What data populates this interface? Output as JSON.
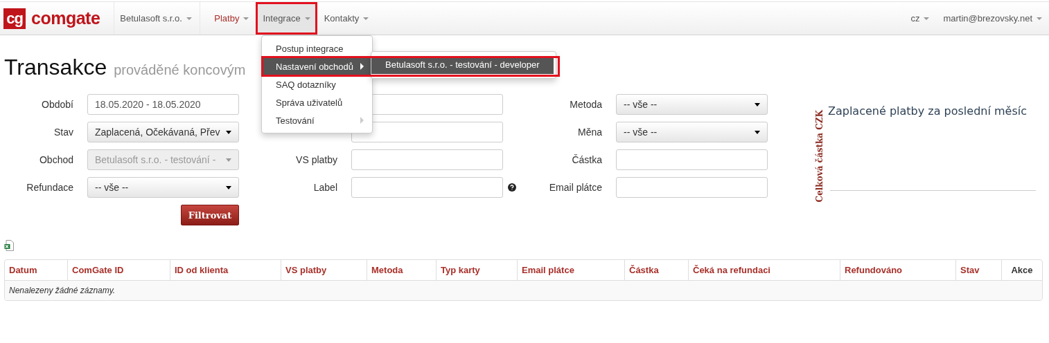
{
  "logo": {
    "mark": "cg",
    "name": "comgate"
  },
  "navbar": {
    "merchant": "Betulasoft s.r.o.",
    "items": [
      {
        "label": "Platby",
        "selected": true,
        "expanded": false,
        "highlighted": false
      },
      {
        "label": "Integrace",
        "selected": false,
        "expanded": true,
        "highlighted": true
      },
      {
        "label": "Kontakty",
        "selected": false,
        "expanded": false,
        "highlighted": false
      }
    ],
    "language": "cz",
    "user": "martin@brezovsky.net"
  },
  "dropdown": {
    "items": [
      {
        "label": "Postup integrace",
        "selected": false,
        "submenu": false,
        "highlighted": false
      },
      {
        "label": "Nastavení obchodů",
        "selected": true,
        "submenu": true,
        "highlighted": true
      },
      {
        "label": "SAQ dotazníky",
        "selected": false,
        "submenu": false,
        "highlighted": false
      },
      {
        "label": "Správa uživatelů",
        "selected": false,
        "submenu": false,
        "highlighted": false
      },
      {
        "label": "Testování",
        "selected": false,
        "submenu": true,
        "highlighted": false
      }
    ],
    "submenu": {
      "items": [
        {
          "label": "Betulasoft s.r.o. - testování - developer",
          "selected": true
        }
      ]
    }
  },
  "page": {
    "title": "Transakce",
    "subtitle": "prováděné koncovým"
  },
  "form": {
    "columns": [
      [
        {
          "label": "Období",
          "kind": "text",
          "value": "18.05.2020 - 18.05.2020",
          "disabled": false,
          "help": false
        },
        {
          "label": "Stav",
          "kind": "select",
          "value": "Zaplacená, Očekávaná, Přev",
          "disabled": false,
          "help": false
        },
        {
          "label": "Obchod",
          "kind": "select",
          "value": "Betulasoft s.r.o. - testování -",
          "disabled": true,
          "help": false
        },
        {
          "label": "Refundace",
          "kind": "select",
          "value": "-- vše --",
          "disabled": false,
          "help": false
        }
      ],
      [
        {
          "kind": "text",
          "disabled": false,
          "help": false
        },
        {
          "kind": "text",
          "disabled": false,
          "help": false
        },
        {
          "label": "VS platby",
          "kind": "text",
          "disabled": false,
          "help": false
        },
        {
          "label": "Label",
          "kind": "text",
          "disabled": false,
          "help": true
        }
      ],
      [
        {
          "label": "Metoda",
          "kind": "select",
          "value": "-- vše --",
          "disabled": false,
          "help": false
        },
        {
          "label": "Měna",
          "kind": "select",
          "value": "-- vše --",
          "disabled": false,
          "help": false
        },
        {
          "label": "Částka",
          "kind": "text",
          "disabled": false,
          "help": false
        },
        {
          "label": "Email plátce",
          "kind": "text",
          "disabled": false,
          "help": false
        }
      ]
    ],
    "submit": "Filtrovat"
  },
  "chart": {
    "title": "Zaplacené platby za poslední měsíc",
    "ylabel": "Celková částka CZK"
  },
  "table": {
    "columns": [
      {
        "label": "Datum",
        "kind": "sortable"
      },
      {
        "label": "ComGate ID",
        "kind": "sortable"
      },
      {
        "label": "ID od klienta",
        "kind": "sortable"
      },
      {
        "label": "VS platby",
        "kind": "sortable"
      },
      {
        "label": "Metoda",
        "kind": "sortable"
      },
      {
        "label": "Typ karty",
        "kind": "sortable"
      },
      {
        "label": "Email plátce",
        "kind": "sortable"
      },
      {
        "label": "Částka",
        "kind": "sortable"
      },
      {
        "label": "Čeká na refundaci",
        "kind": "sortable"
      },
      {
        "label": "Refundováno",
        "kind": "sortable"
      },
      {
        "label": "Stav",
        "kind": "sortable"
      },
      {
        "label": "Akce",
        "kind": "plain"
      }
    ],
    "empty_message": "Nenalezeny žádné záznamy."
  }
}
